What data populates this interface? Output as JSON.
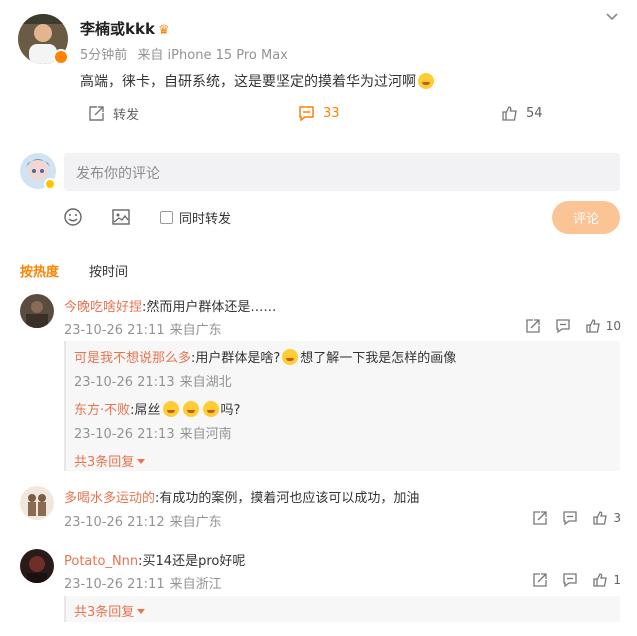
{
  "post": {
    "author": "李楠或kkk",
    "time": "5分钟前",
    "source": "来自 iPhone 15 Pro Max",
    "text": "高端，徕卡，自研系统，这是要坚定的摸着华为过河啊",
    "actions": {
      "repost_label": "转发",
      "comment_count": "33",
      "like_count": "54"
    }
  },
  "composer": {
    "placeholder": "发布你的评论",
    "also_repost_label": "同时转发",
    "submit_label": "评论"
  },
  "sort": {
    "tabs": [
      "按热度",
      "按时间"
    ],
    "active": "按热度"
  },
  "comments": [
    {
      "name": "今晚吃啥好捏",
      "text": ":然而用户群体还是……",
      "time": "23-10-26 21:11",
      "location": "来自广东",
      "likes": "10",
      "replies": [
        {
          "name": "可是我不想说那么多",
          "text_before": ":用户群体是啥?",
          "text_after": "想了解一下我是怎样的画像",
          "time": "23-10-26 21:13",
          "location": "来自湖北"
        },
        {
          "name": "东方·不败",
          "text_before": ":屌丝",
          "text_after": "吗?",
          "time": "23-10-26 21:13",
          "location": "来自河南"
        }
      ],
      "more_replies": "共3条回复"
    },
    {
      "name": "多喝水多运动的",
      "text": ":有成功的案例，摸着河也应该可以成功，加油",
      "time": "23-10-26 21:12",
      "location": "来自广东",
      "likes": "3"
    },
    {
      "name": "Potato_Nnn",
      "text": ":买14还是pro好呢",
      "time": "23-10-26 21:11",
      "location": "来自浙江",
      "likes": "1",
      "more_replies": "共3条回复"
    }
  ],
  "colors": {
    "accent": "#ff8200",
    "username": "#eb7350",
    "submit_button": "#fbc495",
    "muted": "#939393"
  }
}
